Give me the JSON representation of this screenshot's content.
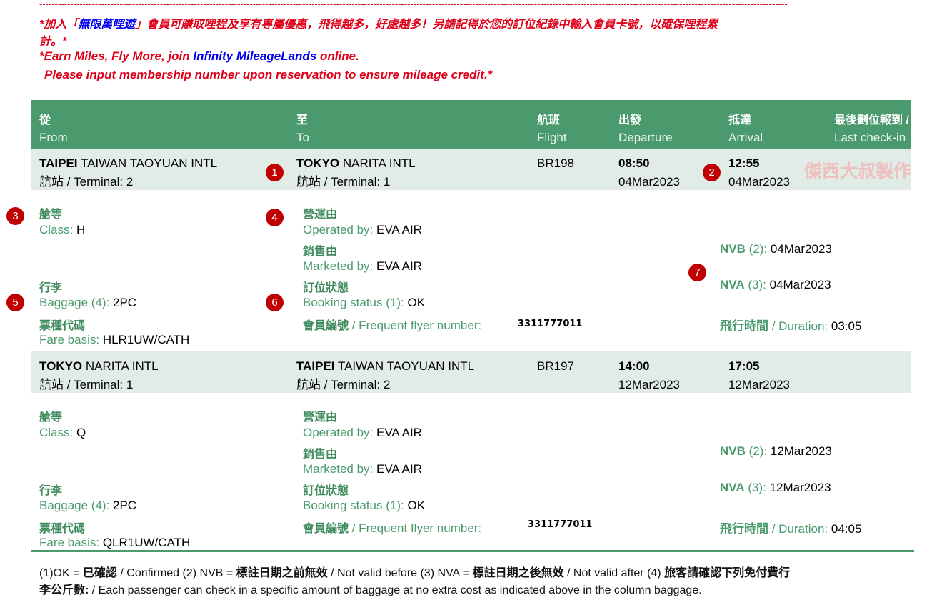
{
  "promo": {
    "zh_line1_pre": "*加入「",
    "zh_link": "無限萬哩遊",
    "zh_line1_post": "」會員可賺取哩程及享有專屬優惠，飛得越多，好處越多！另請記得於您的訂位紀錄中輸入會員卡號，以確保哩程累",
    "zh_line2": "計。*",
    "en_line1_pre": "*Earn Miles, Fly More, join ",
    "en_link": "Infinity MileageLands",
    "en_line1_post": " online.",
    "en_line2": "Please input membership number upon reservation to ensure mileage credit.*"
  },
  "header": {
    "from_zh": "從",
    "from_en": "From",
    "to_zh": "至",
    "to_en": "To",
    "flight_zh": "航班",
    "flight_en": "Flight",
    "departure_zh": "出發",
    "departure_en": "Departure",
    "arrival_zh": "抵達",
    "arrival_en": "Arrival",
    "checkin_zh": "最後劃位報到 /",
    "checkin_en": "Last check-in"
  },
  "labels": {
    "terminal": "航站 / Terminal: ",
    "class_zh": "艙等",
    "class_en": "Class: ",
    "operated_zh": "營運由",
    "operated_en": "Operated by: ",
    "marketed_zh": "銷售由",
    "marketed_en": "Marketed by: ",
    "baggage_zh": "行李",
    "baggage_en": "Baggage (4): ",
    "booking_zh": "訂位狀態",
    "booking_en": "Booking status (1): ",
    "fare_zh": "票種代碼",
    "fare_en": "Fare basis: ",
    "ffn_zh": "會員編號",
    "ffn_en": " / Frequent flyer number:",
    "nvb_a": "NVB",
    "nvb_b": " (2): ",
    "nva_a": "NVA",
    "nva_b": " (3): ",
    "dur_zh": "飛行時間",
    "dur_en": " / Duration: "
  },
  "segments": [
    {
      "from_city": "TAIPEI",
      "from_airport": " TAIWAN TAOYUAN INTL",
      "from_terminal": "2",
      "to_city": "TOKYO",
      "to_airport": " NARITA INTL",
      "to_terminal": "1",
      "flight": "BR198",
      "dep_time": "08:50",
      "dep_date": "04Mar2023",
      "arr_time": "12:55",
      "arr_date": "04Mar2023",
      "class": "H",
      "operated_by": "EVA AIR",
      "marketed_by": "EVA AIR",
      "baggage": "2PC",
      "booking_status": "OK",
      "fare_basis": "HLR1UW/CATH",
      "ffn": "3311777011",
      "nvb": "04Mar2023",
      "nva": "04Mar2023",
      "duration": "03:05"
    },
    {
      "from_city": "TOKYO",
      "from_airport": " NARITA INTL",
      "from_terminal": "1",
      "to_city": "TAIPEI",
      "to_airport": " TAIWAN TAOYUAN INTL",
      "to_terminal": "2",
      "flight": "BR197",
      "dep_time": "14:00",
      "dep_date": "12Mar2023",
      "arr_time": "17:05",
      "arr_date": "12Mar2023",
      "class": "Q",
      "operated_by": "EVA AIR",
      "marketed_by": "EVA AIR",
      "baggage": "2PC",
      "booking_status": "OK",
      "fare_basis": "QLR1UW/CATH",
      "ffn": "3311777011",
      "nvb": "12Mar2023",
      "nva": "12Mar2023",
      "duration": "04:05"
    }
  ],
  "badges": [
    "1",
    "2",
    "3",
    "4",
    "5",
    "6",
    "7"
  ],
  "watermark": "傑西大叔製作",
  "footnote": {
    "p1": "(1)OK = ",
    "b1": "已確認",
    "p2": " / Confirmed (2) NVB = ",
    "b2": "標註日期之前無效",
    "p3": " / Not valid before (3) NVA = ",
    "b3": "標註日期之後無效",
    "p4": " / Not valid after (4) ",
    "b4": "旅客請確認下列免付費行",
    "b5": "李公斤數:",
    "p5": " / Each passenger can check in a specific amount of baggage at no extra cost as indicated above in the column baggage."
  },
  "colors": {
    "header_bg": "#4a9a6d",
    "row_bg": "#e2ece6",
    "promo_red": "#e0001a",
    "badge_red": "#c00000"
  }
}
